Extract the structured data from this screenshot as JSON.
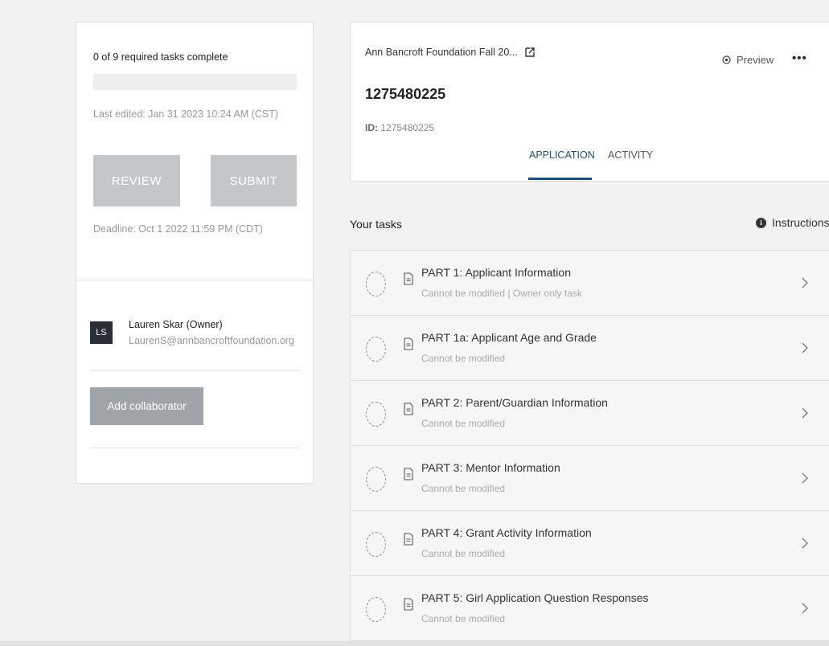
{
  "left_panel": {
    "progress_label": "0 of 9 required tasks complete",
    "progress_fraction": 0,
    "last_edited": "Last edited: Jan 31 2023 10:24 AM (CST)",
    "review_label": "REVIEW",
    "submit_label": "SUBMIT",
    "deadline": "Deadline: Oct 1 2022 11:59 PM (CDT)",
    "owner": {
      "initials": "LS",
      "name": "Lauren Skar (Owner)",
      "email": "LaurenS@annbancroftfoundation.org"
    },
    "add_collaborator_label": "Add collaborator"
  },
  "header": {
    "program_name": "Ann Bancroft Foundation Fall 20...",
    "preview_label": "Preview",
    "more_label": "•••",
    "app_number": "1275480225",
    "id_label": "ID:",
    "id_value": "1275480225",
    "tabs": [
      {
        "label": "APPLICATION",
        "active": true
      },
      {
        "label": "ACTIVITY",
        "active": false
      }
    ]
  },
  "tasks": {
    "title": "Your tasks",
    "instructions_label": "Instructions",
    "items": [
      {
        "title": "PART 1: Applicant Information",
        "subtitle": "Cannot be modified | Owner only task"
      },
      {
        "title": "PART 1a: Applicant Age and Grade",
        "subtitle": "Cannot be modified"
      },
      {
        "title": "PART 2: Parent/Guardian Information",
        "subtitle": "Cannot be modified"
      },
      {
        "title": "PART 3: Mentor Information",
        "subtitle": "Cannot be modified"
      },
      {
        "title": "PART 4: Grant Activity Information",
        "subtitle": "Cannot be modified"
      },
      {
        "title": "PART 5: Girl Application Question Responses",
        "subtitle": "Cannot be modified"
      }
    ]
  },
  "colors": {
    "accent": "#1e4e79",
    "button_disabled": "#c4c7ca",
    "avatar_bg": "#2a2f36"
  }
}
